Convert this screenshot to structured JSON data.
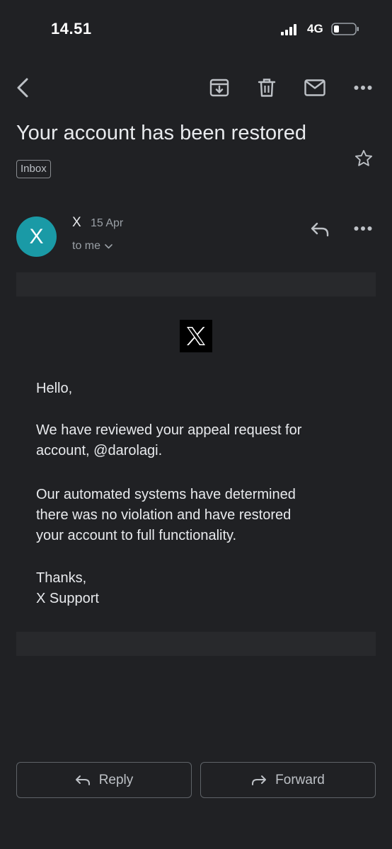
{
  "status_bar": {
    "time": "14.51",
    "network": "4G"
  },
  "toolbar": {
    "back_icon": "chevron-left-icon",
    "archive_icon": "archive-icon",
    "delete_icon": "trash-icon",
    "mark_unread_icon": "envelope-icon",
    "more_icon": "more-horizontal-icon"
  },
  "email": {
    "subject": "Your account has been restored",
    "label": "Inbox",
    "sender": {
      "avatar_letter": "X",
      "name": "X",
      "date": "15 Apr",
      "recipient": "to me",
      "avatar_color": "#1a9aa6"
    },
    "body": {
      "greeting": "Hello,",
      "para1_line1": "We have reviewed your appeal request for",
      "para1_line2": "account, @darolagi.",
      "para2_line1": "Our automated systems have determined",
      "para2_line2": "there was no violation and have restored",
      "para2_line3": "your account to full functionality.",
      "signoff_line1": "Thanks,",
      "signoff_line2": "X Support"
    }
  },
  "actions": {
    "reply_label": "Reply",
    "forward_label": "Forward"
  },
  "colors": {
    "background": "#202124",
    "text": "#e8eaed",
    "muted": "#9aa0a6",
    "border": "#5f6368"
  }
}
